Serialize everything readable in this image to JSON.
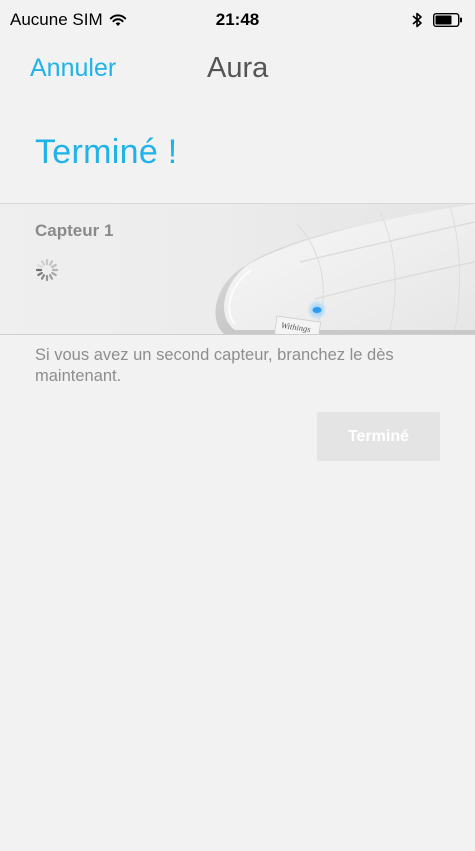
{
  "status_bar": {
    "carrier": "Aucune SIM",
    "time": "21:48"
  },
  "nav": {
    "cancel_label": "Annuler",
    "title": "Aura"
  },
  "heading": "Terminé !",
  "sensor": {
    "label": "Capteur 1",
    "brand_text": "Withings"
  },
  "instruction": "Si vous avez un second capteur, branchez le dès maintenant.",
  "done_button_label": "Terminé",
  "colors": {
    "accent": "#1fb3e8",
    "background": "#f2f2f2",
    "button_disabled": "#e4e4e4",
    "led": "#2f9bf0"
  },
  "icons": [
    "wifi-icon",
    "bluetooth-icon",
    "battery-icon",
    "loading-spinner-icon"
  ]
}
